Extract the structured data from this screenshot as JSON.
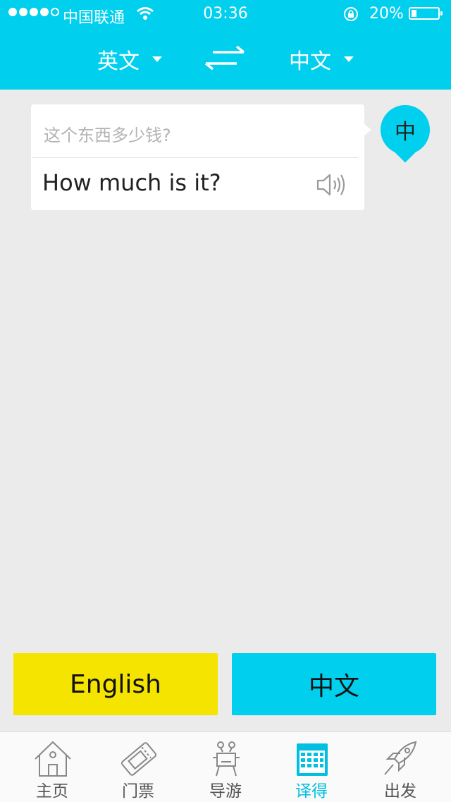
{
  "status_bar": {
    "carrier": "中国联通",
    "time": "03:36",
    "battery": "20%",
    "battery_level": 0.2
  },
  "header": {
    "source_lang": "英文",
    "target_lang": "中文",
    "swap_icon": "swap-arrows-icon"
  },
  "translation": {
    "source_text": "这个东西多少钱?",
    "target_text": "How much is it?",
    "speaker_icon": "speaker-icon",
    "badge": "中"
  },
  "buttons": {
    "english": "English",
    "chinese": "中文"
  },
  "tabs": [
    {
      "label": "主页",
      "icon": "home-icon"
    },
    {
      "label": "门票",
      "icon": "ticket-icon"
    },
    {
      "label": "导游",
      "icon": "guide-icon"
    },
    {
      "label": "译得",
      "icon": "calendar-icon",
      "active": true
    },
    {
      "label": "出发",
      "icon": "rocket-icon"
    }
  ],
  "colors": {
    "accent": "#00cfee",
    "yellow": "#f5e400",
    "background": "#ebebeb"
  }
}
